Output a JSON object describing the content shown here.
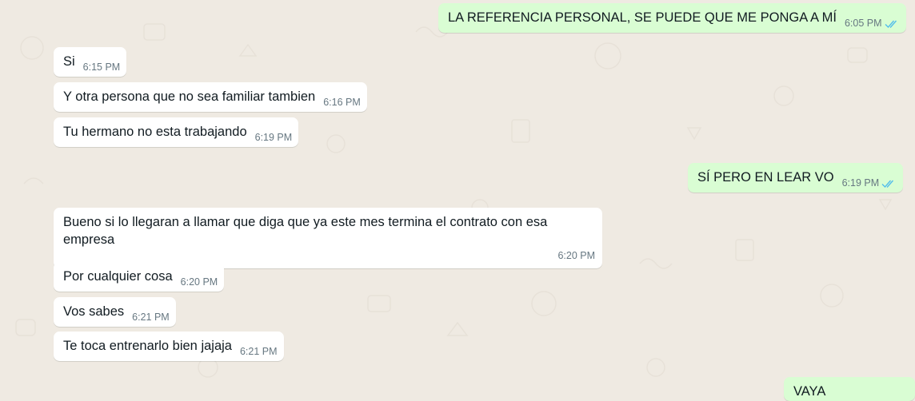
{
  "messages": [
    {
      "direction": "out",
      "text": "LA REFERENCIA PERSONAL, SE PUEDE QUE ME PONGA A MÍ",
      "time": "6:05 PM",
      "status_icon": "double-check-read-icon"
    },
    {
      "direction": "in",
      "text": "Si",
      "time": "6:15 PM"
    },
    {
      "direction": "in",
      "text": "Y otra persona que no sea familiar tambien",
      "time": "6:16 PM"
    },
    {
      "direction": "in",
      "text": "Tu hermano no esta trabajando",
      "time": "6:19 PM"
    },
    {
      "direction": "out",
      "text": "SÍ PERO EN LEAR VO",
      "time": "6:19 PM",
      "status_icon": "double-check-read-icon"
    },
    {
      "direction": "in",
      "text": "Bueno si lo llegaran a llamar que diga que ya este mes termina el contrato con esa empresa",
      "time": "6:20 PM"
    },
    {
      "direction": "in",
      "text": "Por cualquier cosa",
      "time": "6:20 PM"
    },
    {
      "direction": "in",
      "text": "Vos sabes",
      "time": "6:21 PM"
    },
    {
      "direction": "in",
      "text": "Te toca entrenarlo bien jajaja",
      "time": "6:21 PM"
    },
    {
      "direction": "out",
      "text": "VAYA",
      "time": ""
    }
  ],
  "colors": {
    "chat_background": "#efeae2",
    "incoming_bubble": "#ffffff",
    "outgoing_bubble": "#d9fdd3",
    "read_ticks": "#53bdeb",
    "timestamp": "#667781"
  }
}
